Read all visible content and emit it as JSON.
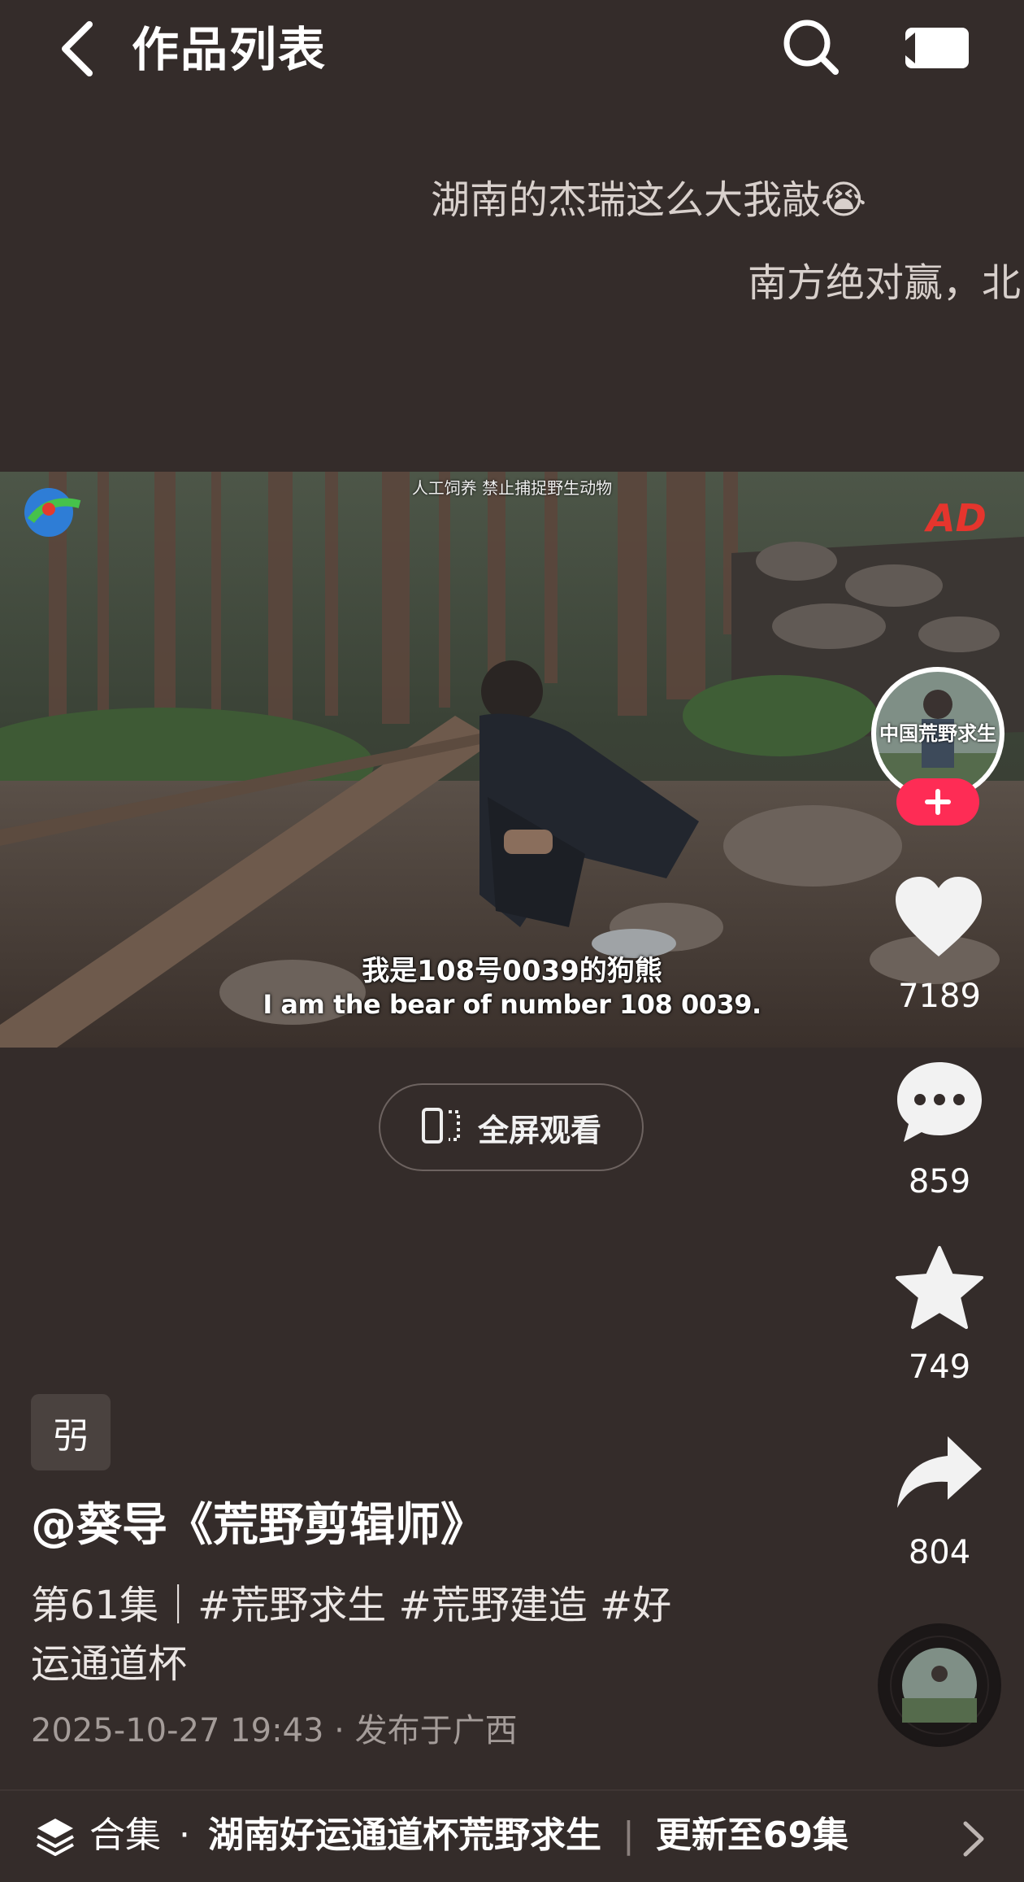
{
  "header": {
    "title": "作品列表",
    "icons": [
      "back-icon",
      "search-icon",
      "cast-icon"
    ]
  },
  "danmaku": [
    "湖南的杰瑞这么大我敲😭",
    "南方绝对赢，北"
  ],
  "video": {
    "top_notice": "人工饲养 禁止捕捉野生动物",
    "caption_cn": "我是108号0039的狗熊",
    "caption_en": "I am the bear of number 108 0039.",
    "watermark_logo_text": "AD",
    "avatar_text": "中国荒野求生"
  },
  "fullscreen": {
    "label": "全屏观看"
  },
  "actions": {
    "like_count": "7189",
    "comment_count": "859",
    "favorite_count": "749",
    "share_count": "804"
  },
  "post": {
    "tag_chip": "弜",
    "author": "@葵导《荒野剪辑师》",
    "description": "第61集 | #荒野求生 #荒野建造 #好运通道杯",
    "desc_line1": "第61集｜#荒野求生 #荒野建造 #好",
    "desc_line2": "运通道杯",
    "meta": "2025-10-27 19:43 · 发布于广西"
  },
  "collection": {
    "prefix": "合集",
    "dot": "·",
    "name": "湖南好运通道杯荒野求生",
    "separator": "|",
    "update": "更新至69集"
  },
  "colors": {
    "background": "#342c2a",
    "accent_red": "#fe2c55",
    "muted_text": "#a49c99"
  }
}
